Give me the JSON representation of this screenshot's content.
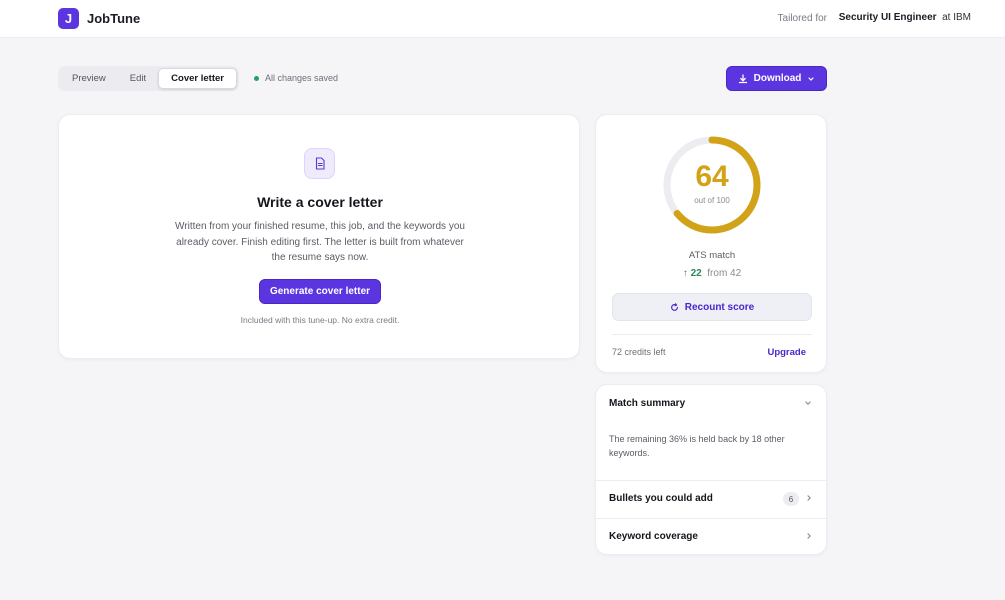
{
  "app": {
    "logo_letter": "J",
    "name": "JobTune"
  },
  "header": {
    "tailored_prefix": "Tailored for",
    "role": "Security UI Engineer",
    "company_text": "at IBM"
  },
  "tabs": [
    {
      "label": "Preview"
    },
    {
      "label": "Edit"
    },
    {
      "label": "Cover letter",
      "active": true
    }
  ],
  "save_status": "All changes saved",
  "download": {
    "label": "Download"
  },
  "cover": {
    "title": "Write a cover letter",
    "description": "Written from your finished resume, this job, and the keywords you already cover. Finish editing first. The letter is built from whatever the resume says now.",
    "button": "Generate cover letter",
    "note": "Included with this tune-up. No extra credit."
  },
  "score": {
    "value": "64",
    "out_of": "out of 100",
    "fraction": 0.64,
    "label": "ATS match",
    "delta": "22",
    "from": "from 42",
    "recount": "Recount score",
    "credits": "72 credits left",
    "upgrade": "Upgrade",
    "color": "#d2a318"
  },
  "summary": {
    "title": "Match summary",
    "text": "The remaining 36% is held back by 18 other keywords.",
    "rows": [
      {
        "label": "Bullets you could add",
        "badge": "6"
      },
      {
        "label": "Keyword coverage"
      }
    ]
  },
  "colors": {
    "accent": "#5b35e0",
    "background": "#f5f5f8",
    "success": "#2a8a5c"
  }
}
